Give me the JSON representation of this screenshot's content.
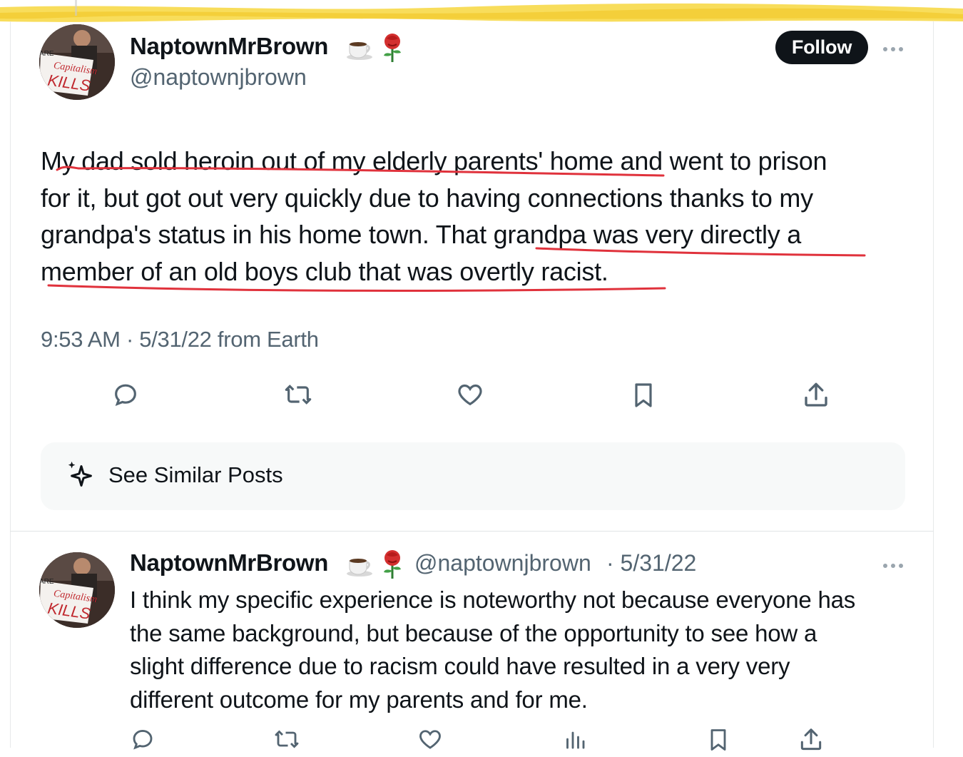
{
  "main_tweet": {
    "author": {
      "display_name": "NaptownMrBrown",
      "handle": "@naptownjbrown",
      "name_emojis": [
        "☕",
        "🌹"
      ],
      "avatar_sign_text": "Capitalism KILLS"
    },
    "follow_label": "Follow",
    "text_lines": [
      "My dad sold heroin out of my elderly parents' home and went to prison",
      "for it, but got out very quickly due to having connections thanks to my",
      "grandpa's status in his home town. That  grandpa was very directly a",
      "member of an old boys club that was overtly racist."
    ],
    "timestamp": "9:53 AM · 5/31/22 from Earth",
    "actions": [
      "reply-icon",
      "retweet-icon",
      "like-icon",
      "bookmark-icon",
      "share-icon"
    ],
    "similar_posts_label": "See Similar Posts"
  },
  "reply_tweet": {
    "author": {
      "display_name": "NaptownMrBrown",
      "handle": "@naptownjbrown",
      "name_emojis": [
        "☕",
        "🌹"
      ]
    },
    "date": "· 5/31/22",
    "text_lines": [
      "I think my specific experience is noteworthy not because everyone has",
      "the same background, but because of the opportunity to see how a",
      "slight difference due to racism could have resulted in a very very",
      "different outcome for my parents and for me."
    ],
    "actions": [
      "reply-icon",
      "retweet-icon",
      "like-icon",
      "views-icon",
      "bookmark-icon",
      "share-icon"
    ]
  },
  "colors": {
    "text_primary": "#0f1419",
    "text_secondary": "#536471",
    "highlight": "#f5d232",
    "annotation_red": "#e0323c",
    "follow_bg": "#0f1419"
  }
}
